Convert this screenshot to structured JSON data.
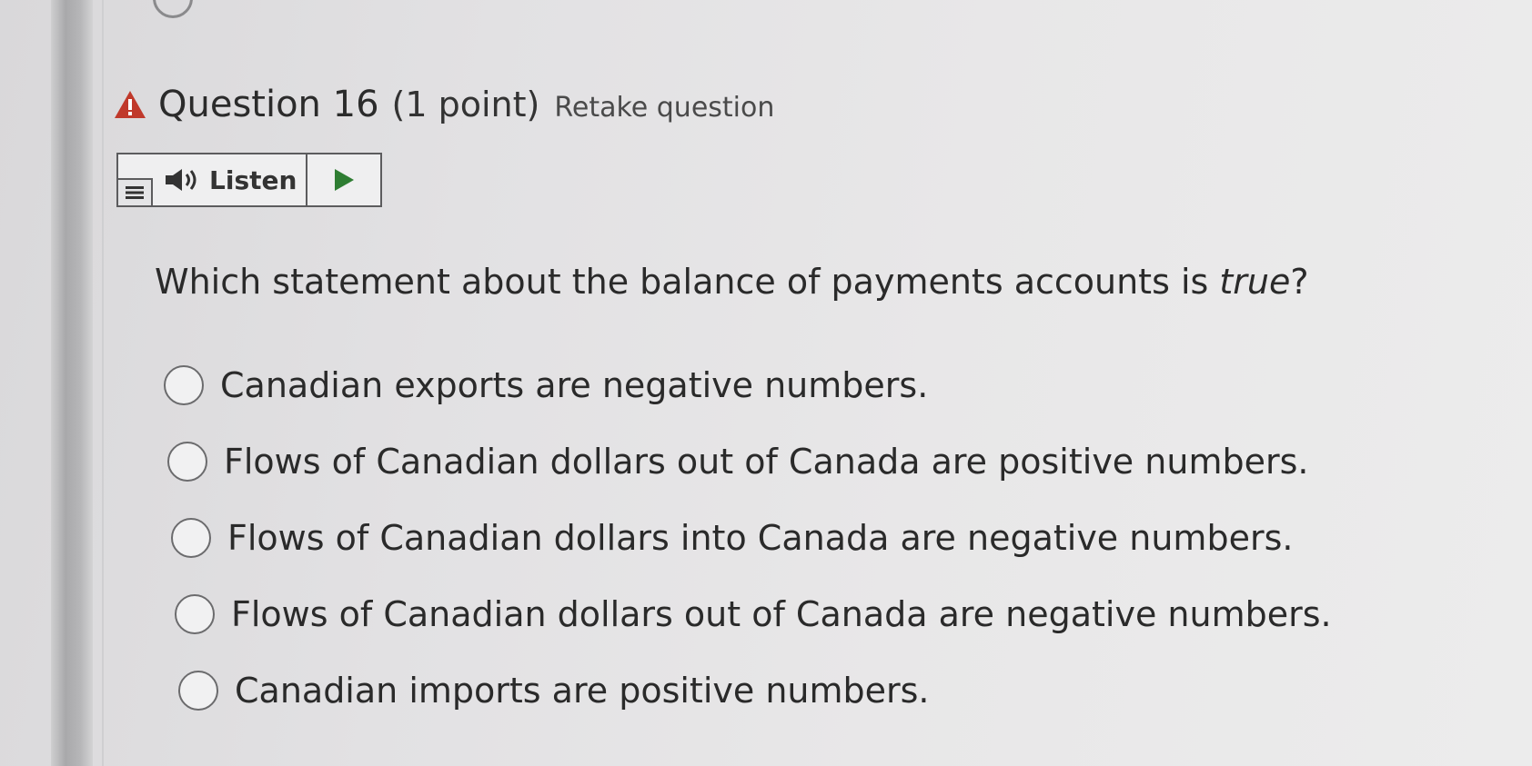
{
  "header": {
    "warning_icon": "warning-triangle-icon",
    "title": "Question 16",
    "points": "(1 point)",
    "retake_label": "Retake question"
  },
  "listen": {
    "label": "Listen",
    "menu_icon": "menu-lines-icon",
    "speaker_icon": "speaker-icon",
    "play_icon": "play-icon"
  },
  "question": {
    "text_before": "Which statement about the balance of payments accounts is ",
    "text_emphasis": "true",
    "text_after": "?"
  },
  "options": [
    {
      "label": "Canadian exports are negative numbers."
    },
    {
      "label": "Flows of Canadian dollars out of Canada are positive numbers."
    },
    {
      "label": "Flows of Canadian dollars into Canada are negative numbers."
    },
    {
      "label": "Flows of Canadian dollars out of Canada are negative numbers."
    },
    {
      "label": "Canadian imports are positive numbers."
    }
  ],
  "colors": {
    "warning": "#c0392b",
    "play": "#2e7d32"
  }
}
